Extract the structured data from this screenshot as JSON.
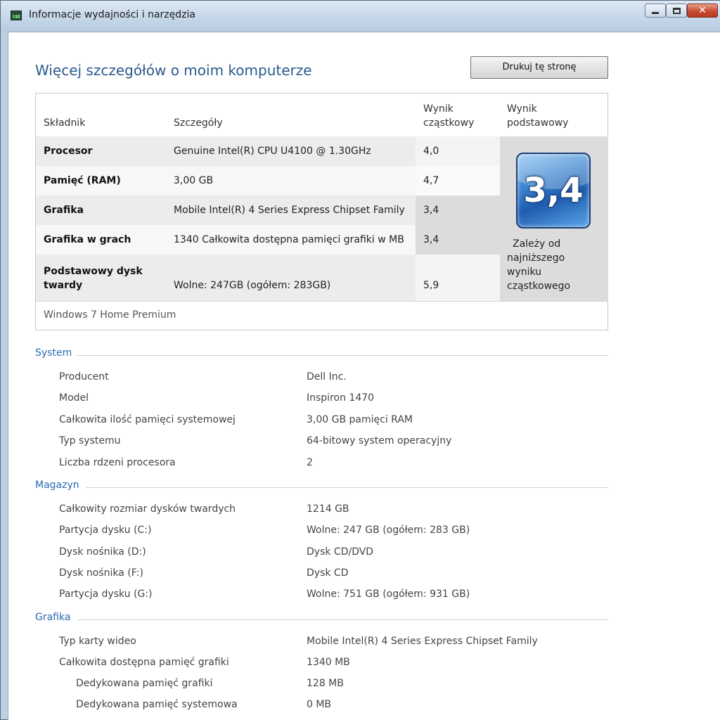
{
  "window": {
    "title": "Informacje wydajności i narzędzia",
    "controls": {
      "close_glyph": "✕"
    }
  },
  "page": {
    "title": "Więcej szczegółów o moim komputerze",
    "print_button": "Drukuj tę stronę"
  },
  "score_table": {
    "headers": {
      "component": "Składnik",
      "details": "Szczegóły",
      "subscore_line1": "Wynik",
      "subscore_line2": "cząstkowy",
      "base_line1": "Wynik",
      "base_line2": "podstawowy"
    },
    "rows": [
      {
        "component": "Procesor",
        "details": "Genuine Intel(R) CPU U4100 @ 1.30GHz",
        "score": "4,0"
      },
      {
        "component": "Pamięć (RAM)",
        "details": "3,00 GB",
        "score": "4,7"
      },
      {
        "component": "Grafika",
        "details": "Mobile Intel(R) 4 Series Express Chipset Family",
        "score": "3,4"
      },
      {
        "component": "Grafika w grach",
        "details": "1340 Całkowita dostępna pamięci grafiki w MB",
        "score": "3,4"
      },
      {
        "component_line1": "Podstawowy dysk",
        "component_line2": "twardy",
        "details": "Wolne: 247GB (ogółem: 283GB)",
        "score": "5,9"
      }
    ],
    "base_score": "3,4",
    "base_note_lines": [
      "Zależy od",
      "najniższego",
      "wyniku",
      "cząstkowego"
    ],
    "os_edition": "Windows 7 Home Premium"
  },
  "sections": [
    {
      "title": "System",
      "items": [
        {
          "label": "Producent",
          "value": "Dell Inc."
        },
        {
          "label": "Model",
          "value": "Inspiron 1470"
        },
        {
          "label": "Całkowita ilość pamięci systemowej",
          "value": "3,00 GB pamięci RAM"
        },
        {
          "label": "Typ systemu",
          "value": "64-bitowy system operacyjny"
        },
        {
          "label": "Liczba rdzeni procesora",
          "value": "2"
        }
      ]
    },
    {
      "title": "Magazyn",
      "items": [
        {
          "label": "Całkowity rozmiar dysków twardych",
          "value": "1214 GB"
        },
        {
          "label": "Partycja dysku (C:)",
          "value": "Wolne: 247 GB (ogółem: 283 GB)"
        },
        {
          "label": "Dysk nośnika (D:)",
          "value": "Dysk CD/DVD"
        },
        {
          "label": "Dysk nośnika (F:)",
          "value": "Dysk CD"
        },
        {
          "label": "Partycja dysku (G:)",
          "value": "Wolne: 751 GB (ogółem: 931 GB)"
        }
      ]
    },
    {
      "title": "Grafika",
      "items": [
        {
          "label": "Typ karty wideo",
          "value": "Mobile Intel(R) 4 Series Express Chipset Family"
        },
        {
          "label": "Całkowita dostępna pamięć grafiki",
          "value": "1340 MB"
        },
        {
          "label": "Dedykowana pamięć grafiki",
          "value": "128 MB"
        },
        {
          "label": "Dedykowana pamięć systemowa",
          "value": "0 MB"
        }
      ]
    }
  ]
}
